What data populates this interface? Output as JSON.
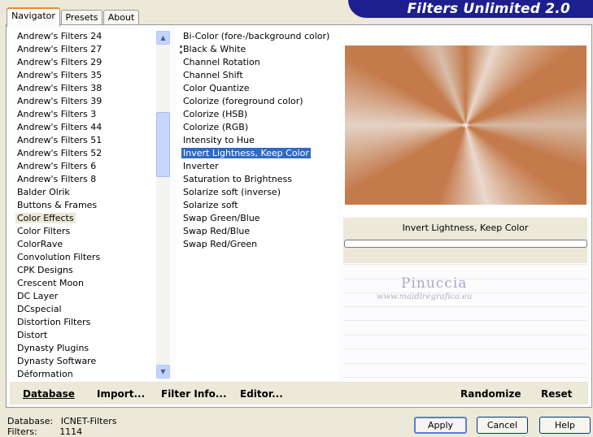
{
  "window": {
    "title": "Filters Unlimited 2.0"
  },
  "tabs": [
    {
      "label": "Navigator",
      "active": true
    },
    {
      "label": "Presets",
      "active": false
    },
    {
      "label": "About",
      "active": false
    }
  ],
  "categories": {
    "items": [
      "Andrew's Filters 24",
      "Andrew's Filters 27",
      "Andrew's Filters 29",
      "Andrew's Filters 35",
      "Andrew's Filters 38",
      "Andrew's Filters 39",
      "Andrew's Filters 3",
      "Andrew's Filters 44",
      "Andrew's Filters 51",
      "Andrew's Filters 52",
      "Andrew's Filters 6",
      "Andrew's Filters 8",
      "Balder Olrik",
      "Buttons & Frames",
      "Color Effects",
      "Color Filters",
      "ColorRave",
      "Convolution Filters",
      "CPK Designs",
      "Crescent Moon",
      "DC Layer",
      "DCspecial",
      "Distortion Filters",
      "Distort",
      "Dynasty Plugins",
      "Dynasty Software",
      "Déformation"
    ],
    "selected_index": 14
  },
  "filters": {
    "items": [
      "Bi-Color (fore-/background color)",
      "Black & White",
      "Channel Rotation",
      "Channel Shift",
      "Color Quantize",
      "Colorize (foreground color)",
      "Colorize (HSB)",
      "Colorize (RGB)",
      "Intensity to Hue",
      "Invert Lightness, Keep Color",
      "Inverter",
      "Saturation to Brightness",
      "Solarize soft (inverse)",
      "Solarize soft",
      "Swap Green/Blue",
      "Swap Red/Blue",
      "Swap Red/Green"
    ],
    "selected_index": 9
  },
  "preview": {
    "filter_name": "Invert Lightness, Keep Color",
    "watermark_name": "Pinuccia",
    "watermark_url": "www.maidiregrafica.eu",
    "colors": {
      "base": "#c47a4b",
      "light": "#e8d8cc"
    }
  },
  "toolbar": {
    "database_label": "Database",
    "import_label": "Import...",
    "filter_info_label": "Filter Info...",
    "editor_label": "Editor...",
    "randomize_label": "Randomize",
    "reset_label": "Reset"
  },
  "status": {
    "database_key": "Database:",
    "database_value": "ICNET-Filters",
    "filters_key": "Filters:",
    "filters_value": "1114"
  },
  "buttons": {
    "apply": "Apply",
    "cancel": "Cancel",
    "help": "Help"
  },
  "theme": {
    "accent": "#e68b2c",
    "selection": "#316ac5",
    "banner": "#1d1f8e"
  }
}
